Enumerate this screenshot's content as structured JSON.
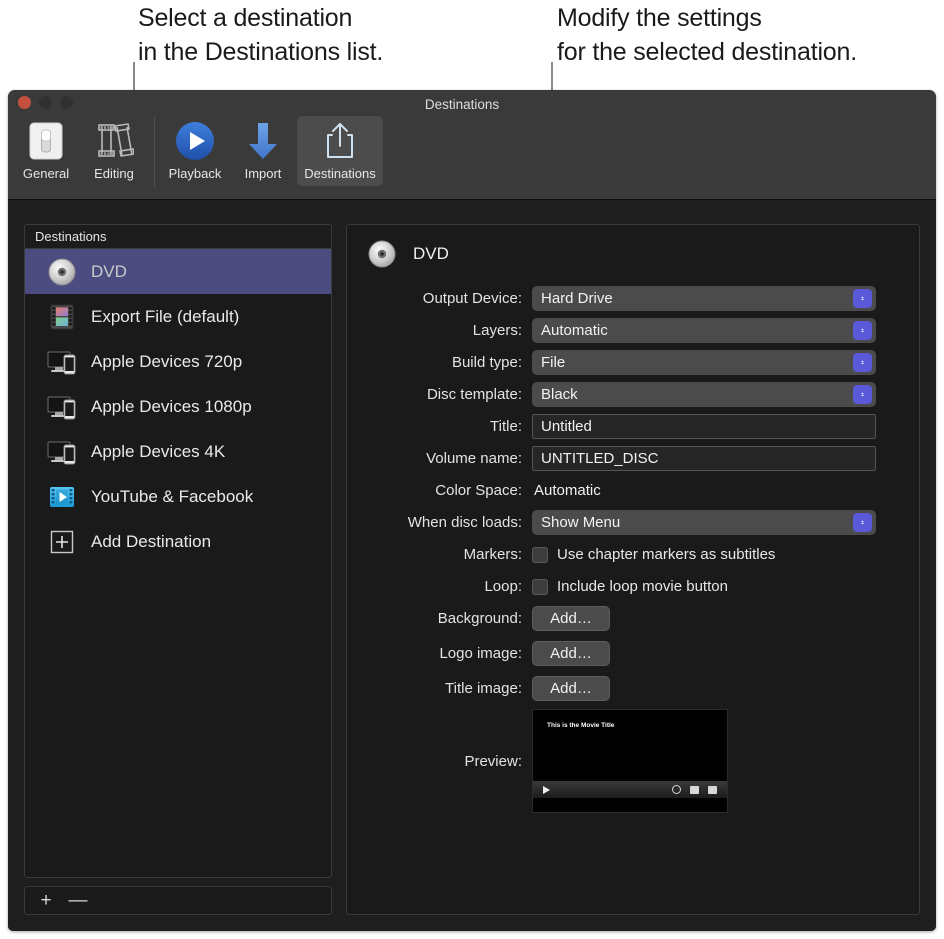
{
  "callouts": {
    "left": "Select a destination\nin the Destinations list.",
    "right": "Modify the settings\nfor the selected destination."
  },
  "window": {
    "title": "Destinations",
    "traffic_lights": [
      "close",
      "minimize",
      "zoom"
    ]
  },
  "toolbar": {
    "items": [
      {
        "label": "General",
        "icon": "general-switch-icon",
        "selected": false
      },
      {
        "label": "Editing",
        "icon": "film-strips-icon",
        "selected": false
      },
      {
        "label": "Playback",
        "icon": "play-circle-icon",
        "selected": false
      },
      {
        "label": "Import",
        "icon": "download-arrow-icon",
        "selected": false
      },
      {
        "label": "Destinations",
        "icon": "share-export-icon",
        "selected": true
      }
    ]
  },
  "sidebar": {
    "header": "Destinations",
    "items": [
      {
        "label": "DVD",
        "icon": "dvd-disc-icon",
        "selected": true
      },
      {
        "label": "Export File (default)",
        "icon": "film-color-icon",
        "selected": false
      },
      {
        "label": "Apple Devices 720p",
        "icon": "apple-devices-icon",
        "selected": false
      },
      {
        "label": "Apple Devices 1080p",
        "icon": "apple-devices-icon",
        "selected": false
      },
      {
        "label": "Apple Devices 4K",
        "icon": "apple-devices-icon",
        "selected": false
      },
      {
        "label": "YouTube & Facebook",
        "icon": "video-share-icon",
        "selected": false
      },
      {
        "label": "Add Destination",
        "icon": "plus-square-icon",
        "selected": false
      }
    ],
    "footer": {
      "add_label": "+",
      "remove_label": "—"
    }
  },
  "detail": {
    "title": "DVD",
    "icon": "dvd-disc-icon",
    "fields": [
      {
        "label": "Output Device:",
        "type": "popup",
        "value": "Hard Drive"
      },
      {
        "label": "Layers:",
        "type": "popup",
        "value": "Automatic"
      },
      {
        "label": "Build type:",
        "type": "popup",
        "value": "File"
      },
      {
        "label": "Disc template:",
        "type": "popup",
        "value": "Black"
      },
      {
        "label": "Title:",
        "type": "text",
        "value": "Untitled"
      },
      {
        "label": "Volume name:",
        "type": "text",
        "value": "UNTITLED_DISC"
      },
      {
        "label": "Color Space:",
        "type": "static",
        "value": "Automatic"
      },
      {
        "label": "When disc loads:",
        "type": "popup",
        "value": "Show Menu"
      },
      {
        "label": "Markers:",
        "type": "checkbox",
        "value": "Use chapter markers as subtitles",
        "checked": false
      },
      {
        "label": "Loop:",
        "type": "checkbox",
        "value": "Include loop movie button",
        "checked": false
      },
      {
        "label": "Background:",
        "type": "button",
        "value": "Add…"
      },
      {
        "label": "Logo image:",
        "type": "button",
        "value": "Add…"
      },
      {
        "label": "Title image:",
        "type": "button",
        "value": "Add…"
      }
    ],
    "preview": {
      "label": "Preview:",
      "movie_title": "This is the Movie Title"
    }
  },
  "colors": {
    "selection": "#4c4c80",
    "stepper": "#5a5ad8",
    "toolbar_bg": "#3a3a3a",
    "panel_bg": "#1a1a1a",
    "window_bg": "#1e1e1e"
  }
}
